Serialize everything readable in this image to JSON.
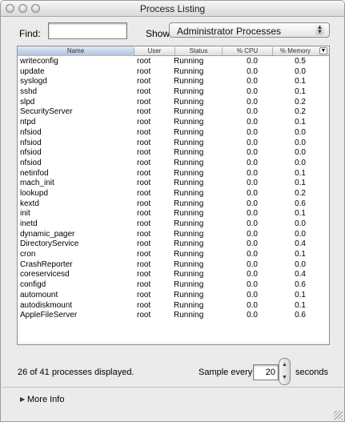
{
  "window": {
    "title": "Process Listing"
  },
  "filter": {
    "find_label": "Find:",
    "find_value": "",
    "show_label": "Show:",
    "show_selected": "Administrator Processes"
  },
  "table": {
    "columns": [
      "Name",
      "User",
      "Status",
      "% CPU",
      "% Memory"
    ],
    "rows": [
      [
        "writeconfig",
        "root",
        "Running",
        "0.0",
        "0.5"
      ],
      [
        "update",
        "root",
        "Running",
        "0.0",
        "0.0"
      ],
      [
        "syslogd",
        "root",
        "Running",
        "0.0",
        "0.1"
      ],
      [
        "sshd",
        "root",
        "Running",
        "0.0",
        "0.1"
      ],
      [
        "slpd",
        "root",
        "Running",
        "0.0",
        "0.2"
      ],
      [
        "SecurityServer",
        "root",
        "Running",
        "0.0",
        "0.2"
      ],
      [
        "ntpd",
        "root",
        "Running",
        "0.0",
        "0.1"
      ],
      [
        "nfsiod",
        "root",
        "Running",
        "0.0",
        "0.0"
      ],
      [
        "nfsiod",
        "root",
        "Running",
        "0.0",
        "0.0"
      ],
      [
        "nfsiod",
        "root",
        "Running",
        "0.0",
        "0.0"
      ],
      [
        "nfsiod",
        "root",
        "Running",
        "0.0",
        "0.0"
      ],
      [
        "netinfod",
        "root",
        "Running",
        "0.0",
        "0.1"
      ],
      [
        "mach_init",
        "root",
        "Running",
        "0.0",
        "0.1"
      ],
      [
        "lookupd",
        "root",
        "Running",
        "0.0",
        "0.2"
      ],
      [
        "kextd",
        "root",
        "Running",
        "0.0",
        "0.6"
      ],
      [
        "init",
        "root",
        "Running",
        "0.0",
        "0.1"
      ],
      [
        "inetd",
        "root",
        "Running",
        "0.0",
        "0.0"
      ],
      [
        "dynamic_pager",
        "root",
        "Running",
        "0.0",
        "0.0"
      ],
      [
        "DirectoryService",
        "root",
        "Running",
        "0.0",
        "0.4"
      ],
      [
        "cron",
        "root",
        "Running",
        "0.0",
        "0.1"
      ],
      [
        "CrashReporter",
        "root",
        "Running",
        "0.0",
        "0.0"
      ],
      [
        "coreservicesd",
        "root",
        "Running",
        "0.0",
        "0.4"
      ],
      [
        "configd",
        "root",
        "Running",
        "0.0",
        "0.6"
      ],
      [
        "automount",
        "root",
        "Running",
        "0.0",
        "0.1"
      ],
      [
        "autodiskmount",
        "root",
        "Running",
        "0.0",
        "0.1"
      ],
      [
        "AppleFileServer",
        "root",
        "Running",
        "0.0",
        "0.6"
      ]
    ]
  },
  "footer": {
    "count_text": "26 of 41 processes displayed.",
    "sample_label": "Sample every",
    "sample_value": "20",
    "seconds_label": "seconds",
    "more_info_label": "More Info"
  },
  "icons": {
    "traffic_lights": [
      "close-icon",
      "minimize-icon",
      "zoom-icon"
    ],
    "popup_arrows": "updown-arrows-icon",
    "disclosure": "disclosure-triangle-icon"
  }
}
